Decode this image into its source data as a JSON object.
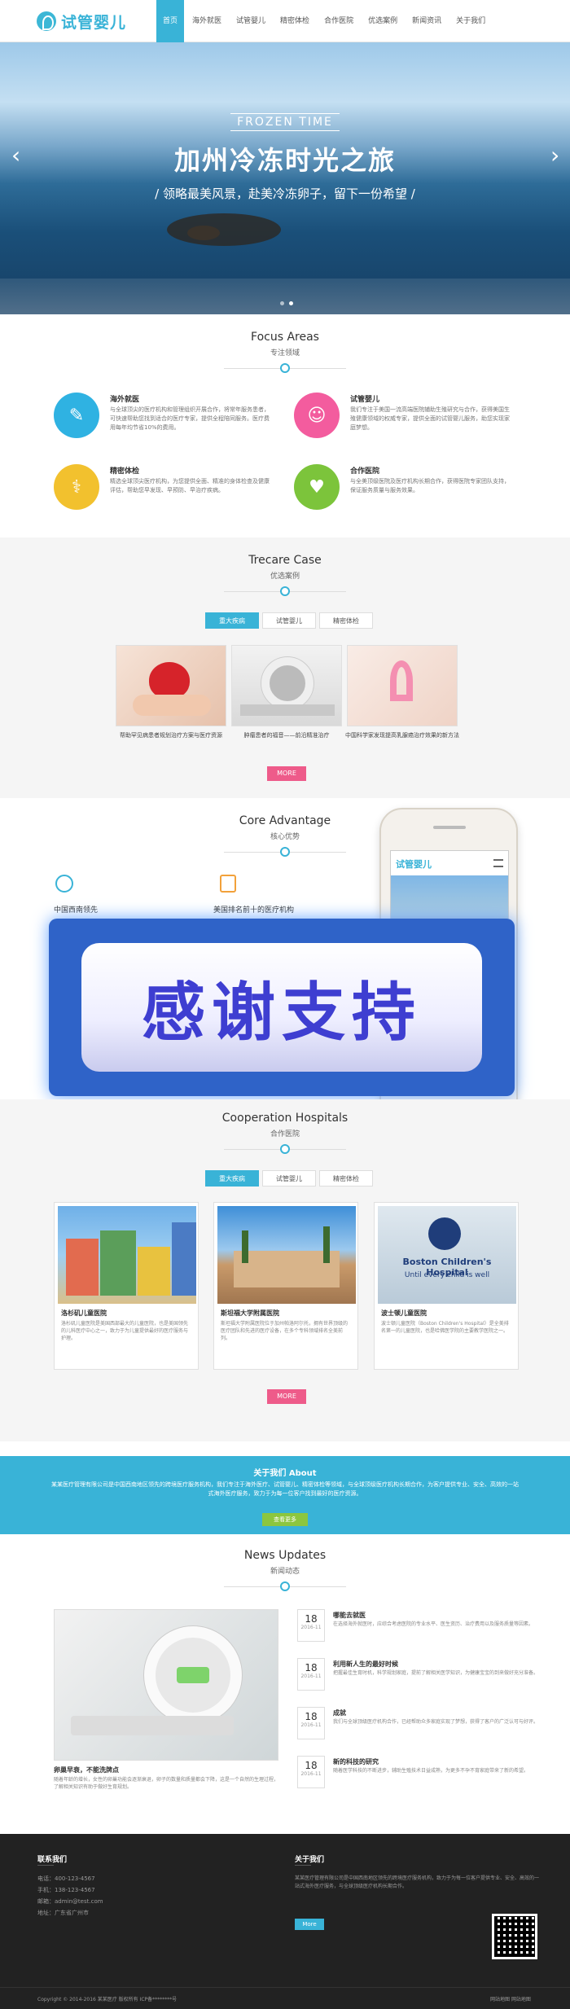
{
  "header": {
    "logo_text": "试管婴儿",
    "nav": [
      "首页",
      "海外就医",
      "试管婴儿",
      "精密体检",
      "合作医院",
      "优选案例",
      "新闻资讯",
      "关于我们"
    ]
  },
  "hero": {
    "subtitle": "FROZEN TIME",
    "title": "加州冷冻时光之旅",
    "caption": "/ 领略最美风景，赴美冷冻卵子，留下一份希望 /",
    "prev": "‹",
    "next": "›"
  },
  "focus": {
    "title": "Focus Areas",
    "subtitle": "专注领域",
    "items": [
      {
        "name": "海外就医",
        "desc": "与全球顶尖的医疗机构和管理组织开展合作，将常年服务患者，可快速帮助您找到适合的医疗专家，提供全程陪同服务。医疗费用每年均节省10%的费用。",
        "icon": "pen-icon",
        "color": "#2fb2e2"
      },
      {
        "name": "试管婴儿",
        "desc": "我们专注于美国一流高端医院辅助生殖研究与合作，获得美国生殖健康领域的权威专家，提供全面的试管婴儿服务，助您实现家庭梦想。",
        "icon": "baby-icon",
        "color": "#f35c9e"
      },
      {
        "name": "精密体检",
        "desc": "精选全球顶尖医疗机构，为您提供全面、精准的身体检查及健康评估，帮助您早发现、早预防、早治疗疾病。",
        "icon": "stethoscope-icon",
        "color": "#f2c12e"
      },
      {
        "name": "合作医院",
        "desc": "与全美顶级医院及医疗机构长期合作，获得医院专家团队支持，保证服务质量与服务效果。",
        "icon": "monitor-icon",
        "color": "#7cc43b"
      }
    ]
  },
  "cases": {
    "title": "Trecare Case",
    "subtitle": "优选案例",
    "tabs": [
      "重大疾病",
      "试管婴儿",
      "精密体检"
    ],
    "items": [
      "帮助罕见病患者规划治疗方案与医疗资源",
      "肿瘤患者的福音——前沿精准治疗",
      "中国科学家发现提高乳腺癌治疗效果的新方法"
    ],
    "more": "MORE"
  },
  "advantage": {
    "title": "Core Advantage",
    "subtitle": "核心优势",
    "items": [
      "中国西南领先",
      "美国排名前十的医疗机构"
    ]
  },
  "banner": {
    "text": "感谢支持"
  },
  "phone": {
    "logo_text": "试管婴儿"
  },
  "hospitals": {
    "title": "Cooperation Hospitals",
    "subtitle": "合作医院",
    "tabs": [
      "重大疾病",
      "试管婴儿",
      "精密体检"
    ],
    "items": [
      {
        "name": "洛杉矶儿童医院",
        "desc": "洛杉矶儿童医院是美国西部最大的儿童医院，也是美国领先的儿科医疗中心之一，致力于为儿童提供最好的医疗服务与护理。"
      },
      {
        "name": "斯坦福大学附属医院",
        "desc": "斯坦福大学附属医院位于加州帕洛阿尔托，拥有世界顶级的医疗团队和先进的医疗设备，在多个专科领域排名全美前列。"
      },
      {
        "name": "波士顿儿童医院",
        "desc": "波士顿儿童医院（Boston Children's Hospital）是全美排名第一的儿童医院，也是哈佛医学院的主要教学医院之一。"
      }
    ],
    "boston_sign": "Boston Children's Hospital",
    "boston_motto": "Until every child is well",
    "more": "MORE"
  },
  "about": {
    "title": "关于我们 About",
    "desc": "某某医疗管理有限公司是中国西南地区领先的跨境医疗服务机构，我们专注于海外医疗、试管婴儿、精密体检等领域，与全球顶级医疗机构长期合作，为客户提供专业、安全、高效的一站式海外医疗服务，致力于为每一位客户找到最好的医疗资源。",
    "button": "查看更多"
  },
  "news": {
    "title": "News Updates",
    "subtitle": "新闻动态",
    "feature_title": "卵巢早衰，不能洗牌点",
    "feature_desc": "随着年龄的增长，女性的卵巢功能会逐渐衰退，卵子的数量和质量都会下降，这是一个自然的生理过程，了解相关知识有助于做好生育规划。",
    "items": [
      {
        "day": "18",
        "ym": "2016-11",
        "title": "哪能去就医",
        "desc": "在选择海外就医时，应综合考虑医院的专业水平、医生资历、治疗费用以及服务质量等因素。"
      },
      {
        "day": "18",
        "ym": "2016-11",
        "title": "利用新人生的最好时候",
        "desc": "把握最佳生育时机，科学规划家庭，提前了解相关医学知识，为健康宝宝的到来做好充分准备。"
      },
      {
        "day": "18",
        "ym": "2016-11",
        "title": "成就",
        "desc": "我们与全球顶级医疗机构合作，已经帮助众多家庭实现了梦想，获得了客户的广泛认可与好评。"
      },
      {
        "day": "18",
        "ym": "2016-11",
        "title": "新的科技的研究",
        "desc": "随着医学科技的不断进步，辅助生殖技术日益成熟，为更多不孕不育家庭带来了新的希望。"
      }
    ]
  },
  "footer": {
    "contact_title": "联系我们",
    "contact_lines": [
      "电话：400-123-4567",
      "手机：138-123-4567",
      "邮箱：admin@test.com",
      "地址：广东省广州市"
    ],
    "about_title": "关于我们",
    "about_desc": "某某医疗管理有限公司是中国西南地区领先的跨境医疗服务机构，致力于为每一位客户提供专业、安全、高效的一站式海外医疗服务，与全球顶级医疗机构长期合作。",
    "about_button": "More",
    "copyright": "Copyright © 2014-2016 某某医疗 版权所有  ICP备********号",
    "links": "网站地图  网站地图"
  }
}
